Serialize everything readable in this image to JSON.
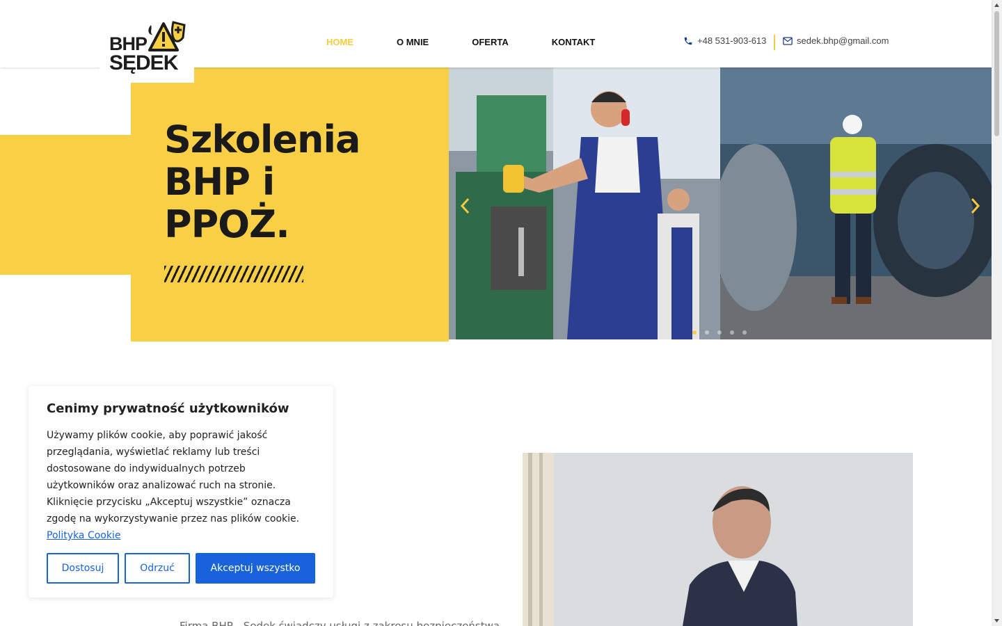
{
  "logo": {
    "line1": "BHP",
    "line2": "SĘDEK"
  },
  "nav": {
    "items": [
      "HOME",
      "O MNIE",
      "OFERTA",
      "KONTAKT"
    ]
  },
  "contact": {
    "phone": "+48 531-903-613",
    "email": "sedek.bhp@gmail.com"
  },
  "hero": {
    "title_lines": [
      "Szkolenia",
      "BHP i",
      "PPOŻ."
    ]
  },
  "cookie": {
    "title": "Cenimy prywatność użytkowników",
    "text": "Używamy plików cookie, aby poprawić jakość przeglądania, wyświetlać reklamy lub treści dostosowane do indywidualnych potrzeb użytkowników oraz analizować ruch na stronie. Kliknięcie przycisku „Akceptuj wszystkie” oznacza zgodę na wykorzystywanie przez nas plików cookie.",
    "link": "Polityka Cookie",
    "btn_customize": "Dostosuj",
    "btn_reject": "Odrzuć",
    "btn_accept": "Akceptuj wszystko"
  },
  "about": {
    "cut_text": "Firma BHP - Sędek świadczy usługi z zakresu bezpieczeństwa"
  },
  "colors": {
    "accent": "#f9cf46",
    "nav_active": "#f5cc3f",
    "cookie_blue": "#1863dc",
    "dark": "#1a1a1a"
  },
  "slider": {
    "dots": 5,
    "active_dot": 0
  },
  "icons": [
    "phone-icon",
    "mail-icon",
    "chevron-left-icon",
    "chevron-right-icon",
    "warning-triangle-icon",
    "flame-icon",
    "shield-plus-icon"
  ]
}
